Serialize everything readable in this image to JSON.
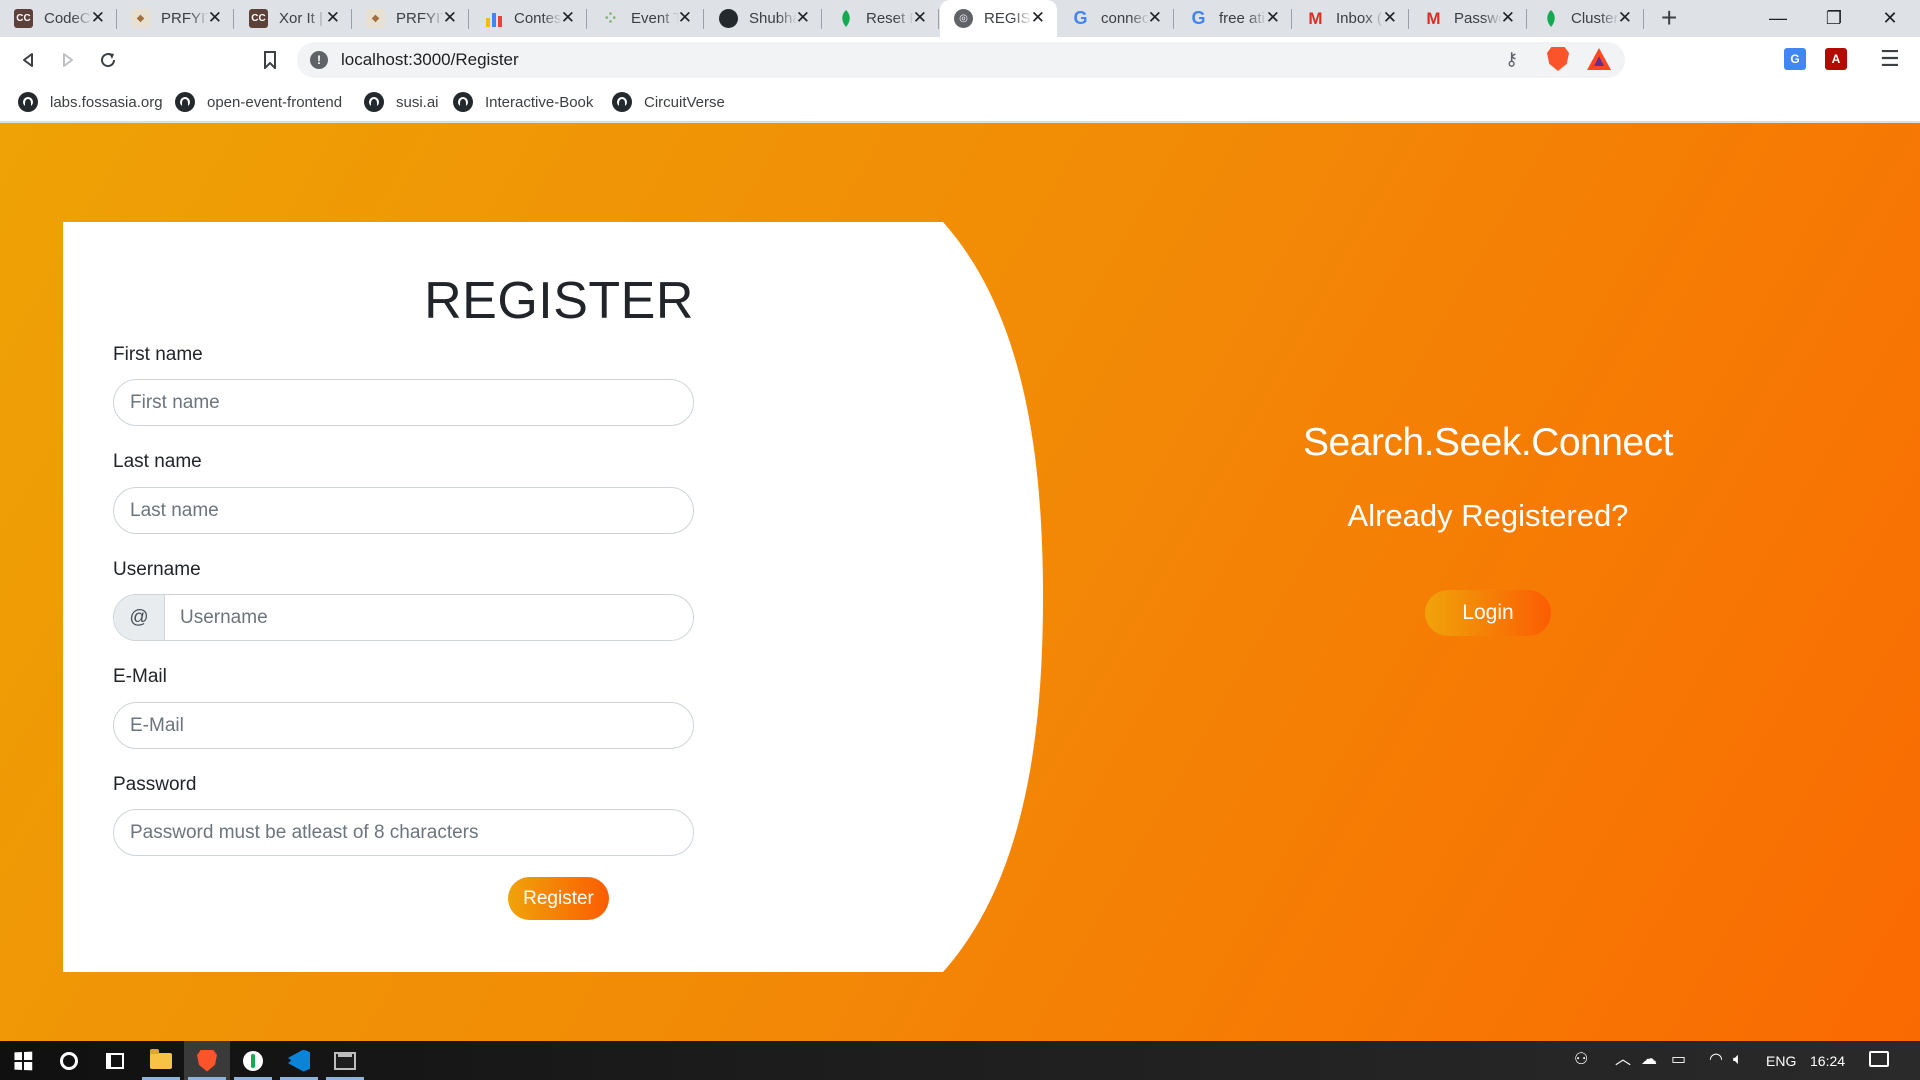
{
  "browser": {
    "tabs": [
      {
        "title": "CodeChef",
        "favicon": "codechef-icon"
      },
      {
        "title": "PRFYIT",
        "favicon": "prfyit-icon"
      },
      {
        "title": "Xor It |",
        "favicon": "codechef-icon"
      },
      {
        "title": "PRFYIT",
        "favicon": "prfyit-icon"
      },
      {
        "title": "Contes",
        "favicon": "bar-chart-icon"
      },
      {
        "title": "Event T",
        "favicon": "dots-icon"
      },
      {
        "title": "Shubha",
        "favicon": "github-icon"
      },
      {
        "title": "Reset P",
        "favicon": "mongodb-leaf-icon"
      },
      {
        "title": "REGIST",
        "favicon": "globe-icon",
        "active": true
      },
      {
        "title": "connec",
        "favicon": "google-icon"
      },
      {
        "title": "free ati",
        "favicon": "google-icon"
      },
      {
        "title": "Inbox (",
        "favicon": "gmail-icon"
      },
      {
        "title": "Passwo",
        "favicon": "gmail-icon"
      },
      {
        "title": "Cluster",
        "favicon": "mongodb-leaf-icon"
      }
    ],
    "url": "localhost:3000/Register",
    "bookmarks": [
      {
        "label": "labs.fossasia.org",
        "icon": "github-icon"
      },
      {
        "label": "open-event-frontend",
        "icon": "github-icon"
      },
      {
        "label": "susi.ai",
        "icon": "github-icon"
      },
      {
        "label": "Interactive-Book",
        "icon": "github-icon"
      },
      {
        "label": "CircuitVerse",
        "icon": "github-icon"
      }
    ]
  },
  "form": {
    "title": "REGISTER",
    "first_name": {
      "label": "First name",
      "placeholder": "First name"
    },
    "last_name": {
      "label": "Last name",
      "placeholder": "Last name"
    },
    "username": {
      "label": "Username",
      "prefix": "@",
      "placeholder": "Username"
    },
    "email": {
      "label": "E-Mail",
      "placeholder": "E-Mail"
    },
    "password": {
      "label": "Password",
      "placeholder": "Password must be atleast of 8 characters"
    },
    "submit_label": "Register"
  },
  "side": {
    "tagline": "Search.Seek.Connect",
    "prompt": "Already Registered?",
    "login_label": "Login"
  },
  "taskbar": {
    "language": "ENG",
    "time": "16:24"
  },
  "colors": {
    "gradient_start": "#eea205",
    "gradient_end": "#fa6a02",
    "button_start": "#f0a30a",
    "button_end": "#fb5d02"
  }
}
